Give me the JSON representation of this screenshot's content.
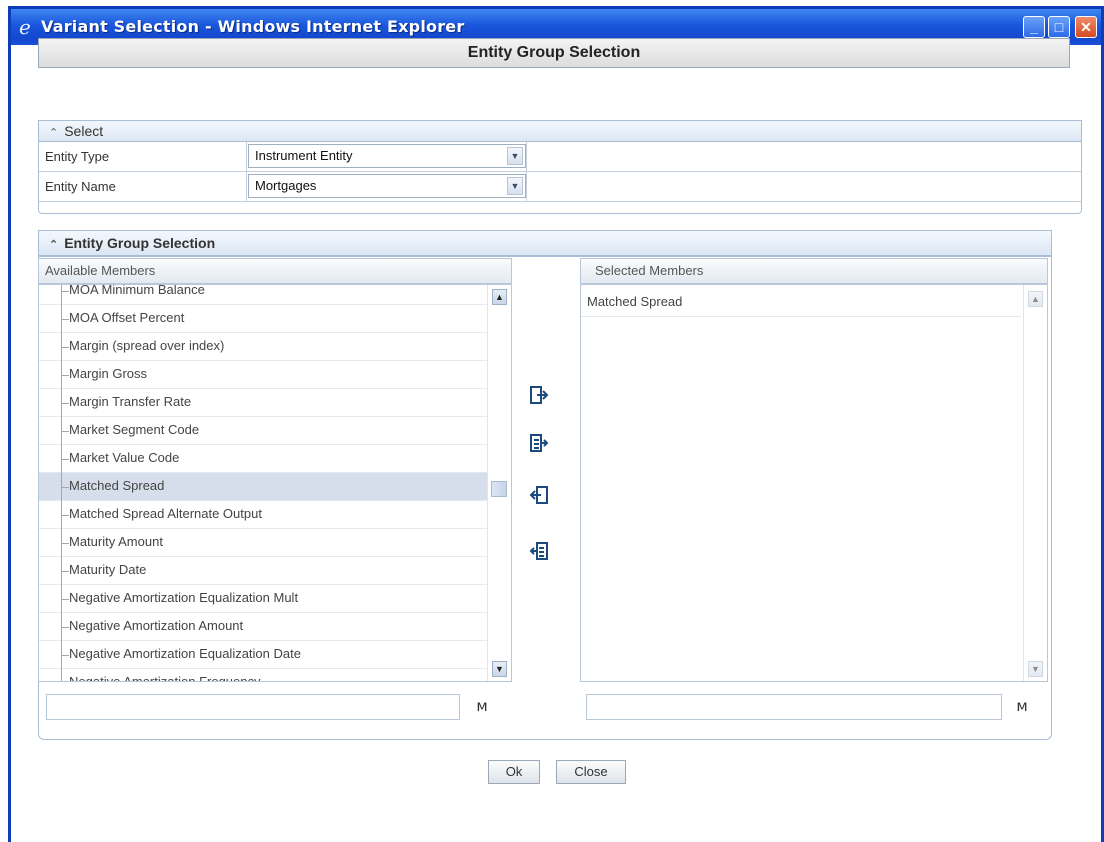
{
  "window": {
    "title": "Variant Selection - Windows Internet Explorer"
  },
  "header": {
    "title": "Entity Group Selection"
  },
  "select_section": {
    "title": "Select",
    "rows": [
      {
        "label": "Entity Type",
        "value": "Instrument Entity"
      },
      {
        "label": "Entity Name",
        "value": "Mortgages"
      }
    ]
  },
  "group_section": {
    "title": "Entity Group Selection",
    "available": {
      "header": "Available Members",
      "items": [
        "MOA Minimum Balance",
        "MOA Offset Percent",
        "Margin (spread over index)",
        "Margin Gross",
        "Margin Transfer Rate",
        "Market Segment Code",
        "Market Value Code",
        "Matched Spread",
        "Matched Spread Alternate Output",
        "Maturity Amount",
        "Maturity Date",
        "Negative Amortization Equalization Mult",
        "Negative Amortization Amount",
        "Negative Amortization Equalization Date",
        "Negative Amortization Frequency"
      ],
      "selected_item": "Matched Spread",
      "search_value": ""
    },
    "selected": {
      "header": "Selected Members",
      "items": [
        "Matched Spread"
      ],
      "search_value": ""
    },
    "move_buttons": [
      "move-selected",
      "move-all",
      "remove-selected",
      "remove-all"
    ]
  },
  "buttons": {
    "ok": "Ok",
    "close": "Close"
  },
  "colors": {
    "titlebar": "#1a56dd",
    "section_bar": "#dce7f4",
    "selected_row": "#d5deea"
  }
}
